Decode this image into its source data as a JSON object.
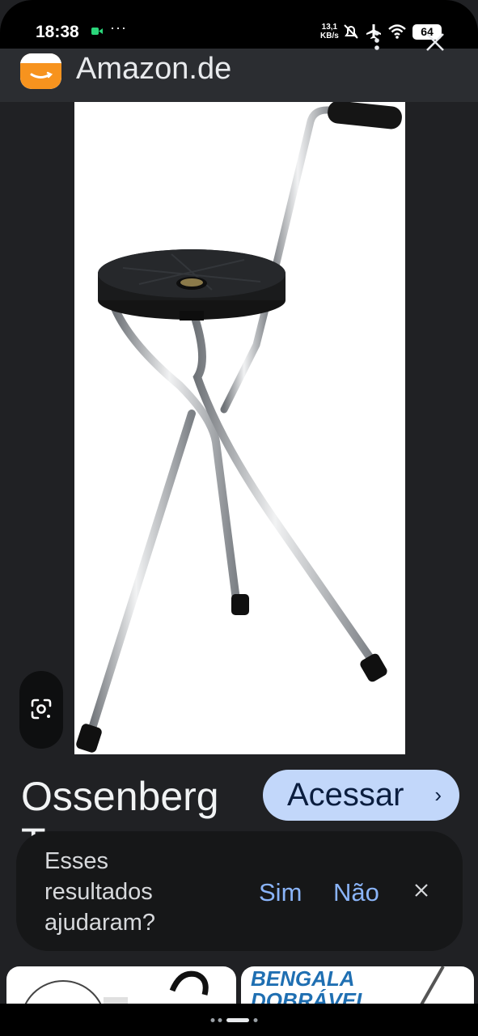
{
  "status_bar": {
    "time": "18:38",
    "more": "···",
    "speed_value": "13,1",
    "speed_unit": "KB/s",
    "battery": "64"
  },
  "header": {
    "site_name": "Amazon.de"
  },
  "result": {
    "title": "Ossenberg",
    "title_line2": "Tr...",
    "visit_label": "Acessar",
    "visit_chevron": "›"
  },
  "feedback": {
    "question": "Esses resultados ajudaram?",
    "yes": "Sim",
    "no": "Não"
  },
  "related": {
    "thumb2_text": "BENGALA DOBRÁVEL"
  },
  "colors": {
    "background": "#202124",
    "accent": "#c2d7fa",
    "link": "#8ab4f8",
    "amazon_orange": "#f7931e"
  }
}
